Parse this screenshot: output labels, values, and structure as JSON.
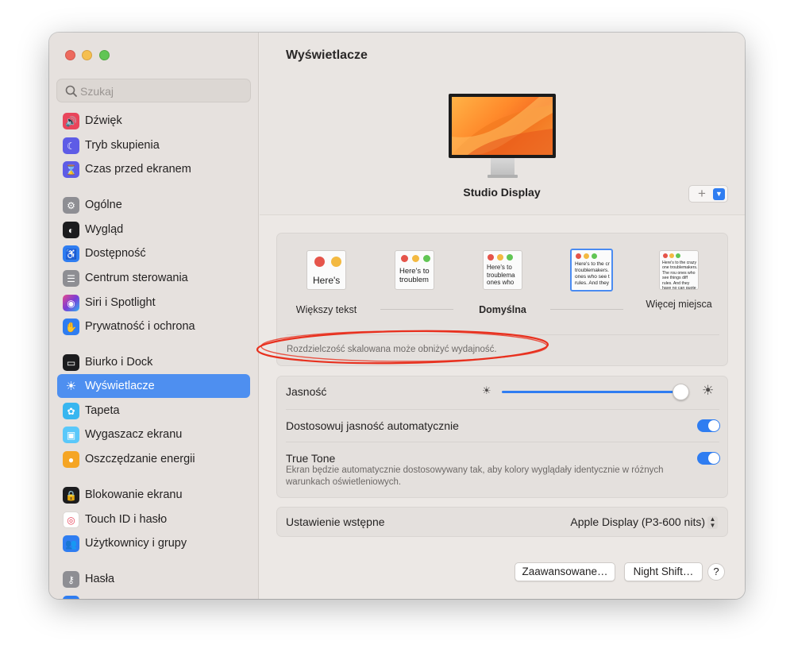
{
  "sidebar": {
    "search_placeholder": "Szukaj",
    "items": [
      {
        "label": "Dźwięk",
        "icon": "speaker-icon",
        "color": "#e9455b"
      },
      {
        "label": "Tryb skupienia",
        "icon": "moon-icon",
        "color": "#5e5ce6"
      },
      {
        "label": "Czas przed ekranem",
        "icon": "hourglass-icon",
        "color": "#5e5ce6"
      },
      {
        "label": "Ogólne",
        "icon": "gear-icon",
        "color": "#8e8e93"
      },
      {
        "label": "Wygląd",
        "icon": "appearance-icon",
        "color": "#1c1c1e"
      },
      {
        "label": "Dostępność",
        "icon": "accessibility-icon",
        "color": "#2f7df1"
      },
      {
        "label": "Centrum sterowania",
        "icon": "control-center-icon",
        "color": "#8e8e93"
      },
      {
        "label": "Siri i Spotlight",
        "icon": "siri-icon",
        "color": "#7a3cd6"
      },
      {
        "label": "Prywatność i ochrona",
        "icon": "hand-icon",
        "color": "#2f7df1"
      },
      {
        "label": "Biurko i Dock",
        "icon": "dock-icon",
        "color": "#1c1c1e"
      },
      {
        "label": "Wyświetlacze",
        "icon": "sun-icon",
        "color": "#2f7df1"
      },
      {
        "label": "Tapeta",
        "icon": "flower-icon",
        "color": "#38b6f0"
      },
      {
        "label": "Wygaszacz ekranu",
        "icon": "screensaver-icon",
        "color": "#5ac8fa"
      },
      {
        "label": "Oszczędzanie energii",
        "icon": "bulb-icon",
        "color": "#f5a524"
      },
      {
        "label": "Blokowanie ekranu",
        "icon": "lock-icon",
        "color": "#1c1c1e"
      },
      {
        "label": "Touch ID i hasło",
        "icon": "fingerprint-icon",
        "color": "#ffffff"
      },
      {
        "label": "Użytkownicy i grupy",
        "icon": "users-icon",
        "color": "#2f7df1"
      },
      {
        "label": "Hasła",
        "icon": "key-icon",
        "color": "#8e8e93"
      }
    ]
  },
  "main": {
    "title": "Wyświetlacze",
    "display_name": "Studio Display",
    "add_button": "+",
    "resolution": {
      "options": [
        {
          "label": "Większy tekst",
          "thumb_text": "Here's"
        },
        {
          "label": "",
          "thumb_text": "Here's to troublem"
        },
        {
          "label": "Domyślna",
          "thumb_text": "Here's to troublema ones who"
        },
        {
          "label": "",
          "thumb_text": "Here's to the cr troublemakers. ones who see t rules. And they"
        },
        {
          "label": "Więcej miejsca",
          "thumb_text": "Here's to the crazy one troublemakers. The rou ones who see things diff rules. And they have no can quote them, disagre them. About the only thi Because they change th"
        }
      ],
      "selected_index": 3,
      "note": "Rozdzielczość skalowana może obniżyć wydajność."
    },
    "brightness": {
      "label": "Jasność",
      "value": 0.95
    },
    "auto_brightness": {
      "label": "Dostosowuj jasność automatycznie",
      "on": true
    },
    "true_tone": {
      "label": "True Tone",
      "on": true,
      "description": "Ekran będzie automatycznie dostosowywany tak, aby kolory wyglądały identycznie w różnych warunkach oświetleniowych."
    },
    "preset": {
      "label": "Ustawienie wstępne",
      "value": "Apple Display (P3-600 nits)"
    },
    "buttons": {
      "advanced": "Zaawansowane…",
      "night_shift": "Night Shift…",
      "help": "?"
    }
  }
}
